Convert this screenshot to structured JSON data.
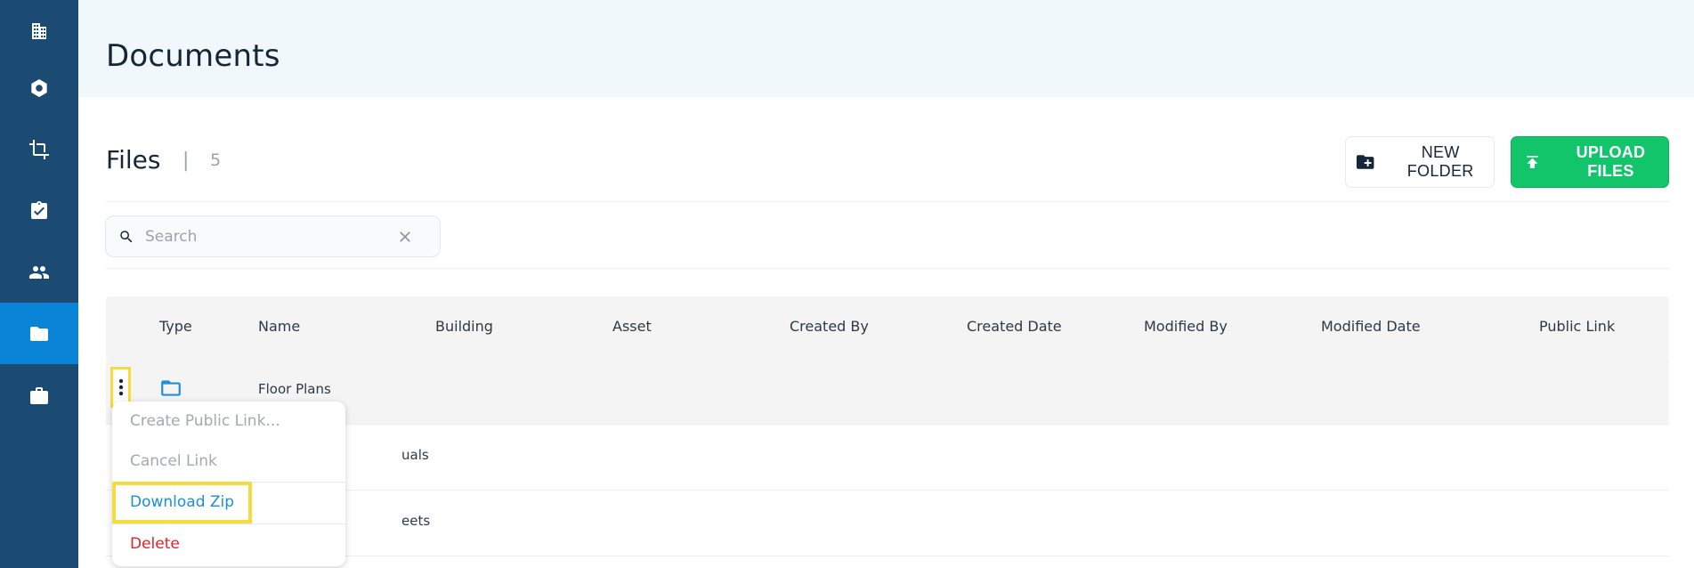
{
  "sidebar": {
    "items": [
      {
        "icon": "building-icon",
        "active": false
      },
      {
        "icon": "hexagon-icon",
        "active": false
      },
      {
        "icon": "crop-icon",
        "active": false
      },
      {
        "icon": "clipboard-check-icon",
        "active": false
      },
      {
        "icon": "people-icon",
        "active": false
      },
      {
        "icon": "folder-icon",
        "active": true
      },
      {
        "icon": "briefcase-icon",
        "active": false
      }
    ],
    "active_color": "#0a84d6",
    "background": "#1b4a73"
  },
  "header": {
    "title": "Documents"
  },
  "files": {
    "title": "Files",
    "separator": "|",
    "count": "5"
  },
  "toolbar": {
    "new_folder_label": "NEW FOLDER",
    "upload_label": "UPLOAD FILES",
    "upload_color": "#12c46a"
  },
  "search": {
    "placeholder": "Search",
    "value": ""
  },
  "table": {
    "columns": [
      "Type",
      "Name",
      "Building",
      "Asset",
      "Created By",
      "Created Date",
      "Modified By",
      "Modified Date",
      "Public Link"
    ],
    "rows": [
      {
        "type": "folder",
        "name": "Floor Plans"
      },
      {
        "type": "folder",
        "name": "uals"
      },
      {
        "type": "folder",
        "name": "eets"
      }
    ]
  },
  "context_menu": {
    "items": [
      {
        "label": "Create Public Link...",
        "state": "disabled"
      },
      {
        "label": "Cancel Link",
        "state": "disabled"
      },
      {
        "label": "Download Zip",
        "state": "highlighted"
      },
      {
        "label": "Delete",
        "state": "danger"
      }
    ]
  },
  "highlight_color": "#f5dd3d"
}
